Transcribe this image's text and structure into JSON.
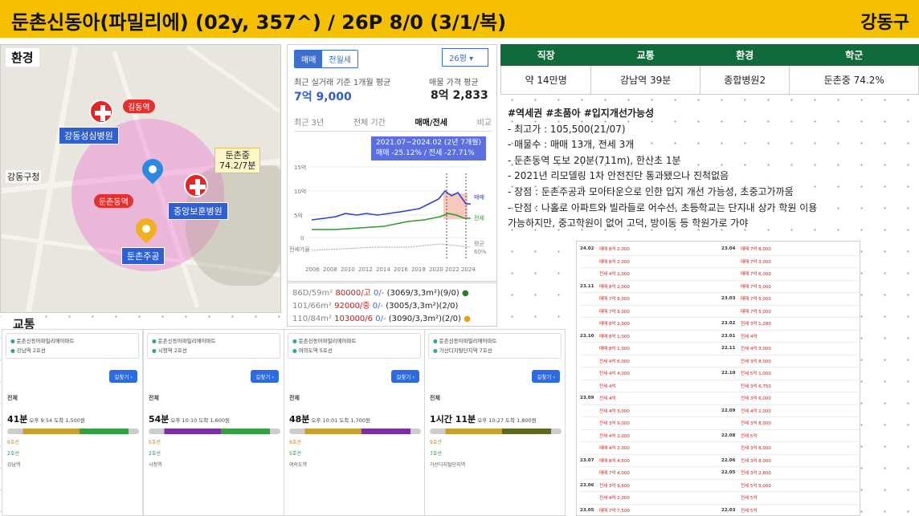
{
  "header": {
    "title": "둔촌신동아(파밀리에) (02y, 357^) / 26P 8/0 (3/1/복)",
    "district": "강동구"
  },
  "sections": {
    "env": "환경",
    "transit": "교통"
  },
  "map": {
    "labels_blue": [
      "강동성심병원",
      "중앙보훈병원",
      "둔촌주공"
    ],
    "labels_red": [
      "길동역",
      "둔촌동역"
    ],
    "area_label": "강동구청",
    "school_label": [
      "둔촌중",
      "74.2/7분"
    ]
  },
  "price_panel": {
    "tabs": [
      "매매",
      "전월세"
    ],
    "size_select": "26평",
    "recent_label": "최근 실거래 기준 1개월 평균",
    "recent_value": "7억 9,000",
    "ask_label": "매물 가격 평균",
    "ask_value": "8억 2,833",
    "period_tabs": [
      "최근 3년",
      "전체 기간",
      "매매/전세",
      "비교"
    ],
    "tooltip_line1": "2021.07~2024.02 (2년 7개월)",
    "tooltip_line2": "매매 -25.12% / 전세 -27.71%",
    "series_labels": [
      "매매",
      "전세",
      "평균",
      "60%"
    ],
    "y_label": "전세가율",
    "y_ticks": [
      "15억",
      "10억",
      "5억",
      "0"
    ],
    "x_ticks": [
      "2006",
      "2008",
      "2010",
      "2012",
      "2014",
      "2016",
      "2018",
      "2020",
      "2022",
      "2024"
    ]
  },
  "sub_rows": [
    {
      "size": "86D/59m²",
      "price": "80000/고",
      "extra": "0/-",
      "detail": "(3069/3,3m²)(9/0)"
    },
    {
      "size": "101/66m²",
      "price": "92000/중",
      "extra": "0/-",
      "detail": "(3005/3,3m²)(2/0)"
    },
    {
      "size": "110/84m²",
      "price": "103000/6",
      "extra": "0/-",
      "detail": "(3090/3,3m²)(2/0)"
    }
  ],
  "info_table": {
    "headers": [
      "직장",
      "교통",
      "환경",
      "학군"
    ],
    "values": [
      "약 14만명",
      "강남역 39분",
      "종합병원2",
      "둔촌중 74.2%"
    ]
  },
  "notes": [
    "#역세권 #초품아 #입지개선가능성",
    "- 최고가 : 105,500(21/07)",
    "- 매물수 : 매매 13개, 전세 3개",
    "- 둔촌동역 도보 20분(711m), 한산초 1분",
    "- 2021년 리모델링 1차 안전진단 통과됐으나 진척없음",
    "- 장점 : 둔촌주공과 모아타운으로 인한 입지 개선 가능성, 초중고가까움",
    "- 단점 : 나홀로 아파트와 빌라들로 어수선, 초등학교는 단지내 상가 학원 이용",
    "가능하지만, 중고학원이 없어 고덕, 방이동 등 학원가로 가야"
  ],
  "listings": {
    "left": [
      {
        "date": "24.02",
        "price": "매매 8억 2,000"
      },
      {
        "date": "",
        "price": "매매 8억 2,000"
      },
      {
        "date": "",
        "price": "전세 4억 2,000"
      },
      {
        "date": "23.11",
        "price": "매매 8억 2,000"
      },
      {
        "date": "",
        "price": "매매 7억 9,000"
      },
      {
        "date": "",
        "price": "매매 7억 9,000"
      },
      {
        "date": "",
        "price": "매매 8억 2,000"
      },
      {
        "date": "23.10",
        "price": "매매 8억 1,000"
      },
      {
        "date": "",
        "price": "매매 8억 1,000"
      },
      {
        "date": "",
        "price": "전세 4억 6,000"
      },
      {
        "date": "",
        "price": "전세 4억 4,000"
      },
      {
        "date": "",
        "price": "전세 4억"
      },
      {
        "date": "23.09",
        "price": "전세 4억"
      },
      {
        "date": "",
        "price": "전세 4억 3,000"
      },
      {
        "date": "",
        "price": "전세 3억 9,000"
      },
      {
        "date": "",
        "price": "전세 4억 2,000"
      },
      {
        "date": "",
        "price": "매매 4억 2,000"
      },
      {
        "date": "23.07",
        "price": "매매 8억 4,500"
      },
      {
        "date": "",
        "price": "매매 7억 4,000"
      },
      {
        "date": "23.06",
        "price": "전세 3억 9,600"
      },
      {
        "date": "",
        "price": "전세 4억 2,000"
      },
      {
        "date": "23.05",
        "price": "매매 7억 7,500"
      },
      {
        "date": "",
        "price": "매매 7억 7,750"
      }
    ],
    "right": [
      {
        "date": "23.04",
        "price": "매매 7억 6,000"
      },
      {
        "date": "",
        "price": "매매 7억 3,000"
      },
      {
        "date": "",
        "price": "매매 7억 6,000"
      },
      {
        "date": "",
        "price": "매매 7억 5,000"
      },
      {
        "date": "23.03",
        "price": "매매 7억 5,000"
      },
      {
        "date": "",
        "price": "매매 7억 5,000"
      },
      {
        "date": "23.02",
        "price": "전세 3억 1,280"
      },
      {
        "date": "23.01",
        "price": "전세 4억"
      },
      {
        "date": "22.11",
        "price": "전세 4억 3,000"
      },
      {
        "date": "",
        "price": "전세 3억 8,000"
      },
      {
        "date": "22.10",
        "price": "전세 5억 1,000"
      },
      {
        "date": "",
        "price": "전세 3억 6,750"
      },
      {
        "date": "",
        "price": "전세 3억 6,000"
      },
      {
        "date": "22.09",
        "price": "전세 4억 2,000"
      },
      {
        "date": "",
        "price": "전세 3억 8,000"
      },
      {
        "date": "22.08",
        "price": "전세 5억"
      },
      {
        "date": "",
        "price": "전세 3억 6,000"
      },
      {
        "date": "22.06",
        "price": "전세 3억 8,000"
      },
      {
        "date": "22.05",
        "price": "전세 3억 2,800"
      },
      {
        "date": "",
        "price": "전세 5억 5,000"
      },
      {
        "date": "",
        "price": "전세 5억"
      },
      {
        "date": "22.03",
        "price": "전세 5억"
      },
      {
        "date": "22.02",
        "price": "매매 9억 2,000"
      }
    ]
  },
  "transit": [
    {
      "from": "둔촌신동아파밀리에아파트",
      "to": "강남역 2호선",
      "btn": "길찾기",
      "tab": "전체",
      "dur": "41분",
      "time": "오후 9:54 도착",
      "fare": "1,500원",
      "stops": [
        "9호선",
        "2호선",
        "강남역"
      ]
    },
    {
      "from": "둔촌신동아파밀리에아파트",
      "to": "시청역 2호선",
      "btn": "길찾기",
      "tab": "전체",
      "dur": "54분",
      "time": "오후 10:10 도착",
      "fare": "1,600원",
      "stops": [
        "5호선",
        "2호선",
        "시청역"
      ]
    },
    {
      "from": "둔촌신동아파밀리에아파트",
      "to": "여의도역 5호선",
      "btn": "길찾기",
      "tab": "전체",
      "dur": "48분",
      "time": "오후 10:01 도착",
      "fare": "1,700원",
      "stops": [
        "9호선",
        "5호선",
        "여의도역"
      ]
    },
    {
      "from": "둔촌신동아파밀리에아파트",
      "to": "가산디지털단지역 7호선",
      "btn": "길찾기",
      "tab": "전체",
      "dur": "1시간 11분",
      "time": "오후 10:27 도착",
      "fare": "1,800원",
      "stops": [
        "9호선",
        "7호선",
        "가산디지털단지역"
      ]
    }
  ]
}
